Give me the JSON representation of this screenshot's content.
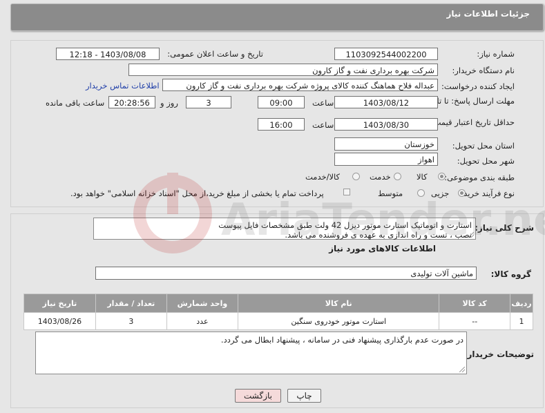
{
  "header": {
    "title": "جزئیات اطلاعات نیاز"
  },
  "form": {
    "need_number_label": "شماره نیاز:",
    "need_number": "1103092544002200",
    "announce_label": "تاریخ و ساعت اعلان عمومی:",
    "announce_value": "1403/08/08 - 12:18",
    "buyer_org_label": "نام دستگاه خریدار:",
    "buyer_org": "شرکت بهره برداری نفت و گاز کارون",
    "requester_label": "ایجاد کننده درخواست:",
    "requester": "عبداله فلاح هماهنگ کننده کالای پروژه شرکت بهره برداری نفت و گاز کارون",
    "contact_link": "اطلاعات تماس خریدار",
    "reply_deadline_label": "مهلت ارسال پاسخ: تا تاریخ:",
    "reply_date": "1403/08/12",
    "time_label": "ساعت",
    "reply_time": "09:00",
    "days_value": "3",
    "days_label": "روز و",
    "remaining_time": "20:28:56",
    "remaining_label": "ساعت باقی مانده",
    "price_validity_label": "حداقل تاریخ اعتبار قیمت: تا تاریخ:",
    "price_date": "1403/08/30",
    "price_time": "16:00",
    "province_label": "استان محل تحویل:",
    "province": "خوزستان",
    "city_label": "شهر محل تحویل:",
    "city": "اهواز",
    "category_label": "طبقه بندی موضوعی:",
    "category_options": [
      "کالا",
      "خدمت",
      "کالا/خدمت"
    ],
    "purchase_type_label": "نوع فرآیند خرید :",
    "purchase_options": [
      "جزیی",
      "متوسط"
    ],
    "payment_note": "پرداخت تمام یا بخشی از مبلغ خرید،از محل \"اسناد خزانه اسلامی\" خواهد بود."
  },
  "description": {
    "label": "شرح کلی نیاز:",
    "text_line1": "استارت و اتوماتیک استارت موتور دیزل 42 ولت طبق مشخصات فایل پیوست",
    "text_line2": "نصب ، تست و راه اندازی به عهده ی فروشنده می باشد."
  },
  "goods": {
    "section_title": "اطلاعات کالاهای مورد نیاز",
    "group_label": "گروه کالا:",
    "group_value": "ماشین آلات تولیدی",
    "table": {
      "headers": [
        "ردیف",
        "کد کالا",
        "نام کالا",
        "واحد شمارش",
        "تعداد / مقدار",
        "تاریخ نیاز"
      ],
      "rows": [
        [
          "1",
          "--",
          "استارت موتور خودروی سنگین",
          "عدد",
          "3",
          "1403/08/26"
        ]
      ]
    }
  },
  "buyer_notes": {
    "label": "توضیحات خریدار:",
    "text": "در صورت عدم بارگذاری پیشنهاد فنی در سامانه ، پیشنهاد ابطال می گردد."
  },
  "buttons": {
    "print": "چاپ",
    "back": "بازگشت"
  },
  "watermark": {
    "text": "AriaTender.net"
  },
  "colors": {
    "header_bg": "#8b8b8b",
    "table_header_bg": "#9a9a9a",
    "link": "#1f3ea8",
    "back_button_bg": "#f5dada"
  }
}
